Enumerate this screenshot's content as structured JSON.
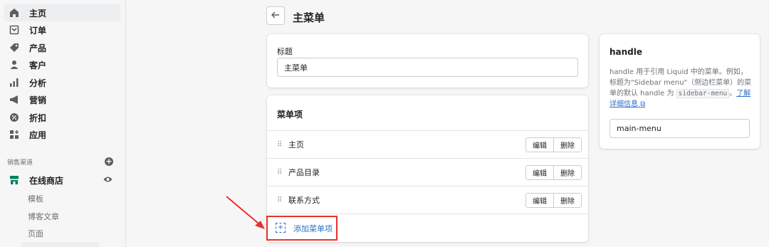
{
  "sidebar": {
    "items": [
      {
        "label": "主页",
        "icon": "home-icon",
        "active": true
      },
      {
        "label": "订单",
        "icon": "orders-icon"
      },
      {
        "label": "产品",
        "icon": "tag-icon"
      },
      {
        "label": "客户",
        "icon": "person-icon"
      },
      {
        "label": "分析",
        "icon": "bar-chart-icon"
      },
      {
        "label": "营销",
        "icon": "megaphone-icon"
      },
      {
        "label": "折扣",
        "icon": "discount-icon"
      },
      {
        "label": "应用",
        "icon": "apps-icon"
      }
    ],
    "sales_channels_title": "销售渠道",
    "online_store": "在线商店",
    "sub_items": [
      "模板",
      "博客文章",
      "页面"
    ]
  },
  "header": {
    "title": "主菜单"
  },
  "title_card": {
    "label": "标题",
    "value": "主菜单"
  },
  "menu_items_card": {
    "title": "菜单项",
    "rows": [
      {
        "label": "主页"
      },
      {
        "label": "产品目录"
      },
      {
        "label": "联系方式"
      }
    ],
    "edit_label": "编辑",
    "delete_label": "删除",
    "add_label": "添加菜单项"
  },
  "handle_card": {
    "title": "handle",
    "desc_part1": "handle 用于引用 Liquid 中的菜单。例如，标题为\"Sidebar menu\"（侧边栏菜单）的菜单的默认 handle 为 ",
    "code": "sidebar-menu",
    "desc_part2": "。",
    "link": "了解详细信息",
    "value": "main-menu"
  },
  "colors": {
    "accent": "#2c6ecb",
    "annotation": "#e8312f",
    "store_green": "#008060"
  }
}
